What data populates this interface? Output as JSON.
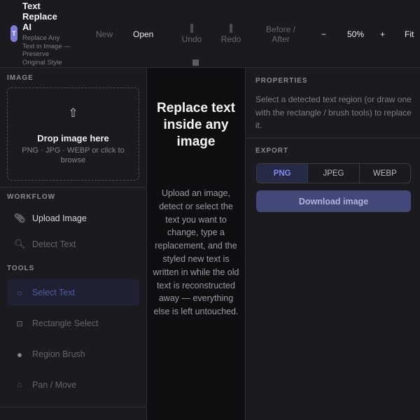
{
  "app": {
    "title": "Text Replace AI",
    "subtitle": "Replace Any Text in Image — Preserve Original Style",
    "logo_letter": "T",
    "accent": "#7f7bd8"
  },
  "toolbar": {
    "new_label": "New",
    "open_label": "Open",
    "undo_label": "Undo",
    "redo_label": "Redo",
    "before_after_label": "Before / After",
    "zoom_out_label": "−",
    "zoom_level": "50%",
    "zoom_in_label": "+",
    "fit_label": "Fit"
  },
  "left_panel": {
    "image_section_label": "IMAGE",
    "dropzone": {
      "icon": "upload-arrow-icon",
      "title": "Drop image here",
      "subtitle": "PNG · JPG · WEBP or click to browse"
    },
    "workflow_label": "WORKFLOW",
    "workflow_items": [
      {
        "label": "Upload Image",
        "icon": "paperclip-icon",
        "enabled": true
      },
      {
        "label": "Detect Text",
        "icon": "magnifier-icon",
        "enabled": false
      }
    ],
    "tools_label": "TOOLS",
    "tool_items": [
      {
        "label": "Select Text",
        "icon": "circle-select-icon",
        "selected": true
      },
      {
        "label": "Rectangle Select",
        "icon": "rectangle-select-icon",
        "selected": false
      },
      {
        "label": "Region Brush",
        "icon": "brush-dot-icon",
        "selected": false
      },
      {
        "label": "Pan / Move",
        "icon": "hand-icon",
        "selected": false
      }
    ]
  },
  "canvas": {
    "title": "Replace text inside any image",
    "body": "Upload an image, detect or select the text you want to change, type a replacement, and the styled new text is written in while the old text is reconstructed away — everything else is left untouched."
  },
  "right_panel": {
    "properties_label": "PROPERTIES",
    "properties_text": "Select a detected text region (or draw one with the rectangle / brush tools) to replace it.",
    "export_label": "EXPORT",
    "formats": [
      {
        "label": "PNG",
        "active": true
      },
      {
        "label": "JPEG",
        "active": false
      },
      {
        "label": "WEBP",
        "active": false
      }
    ],
    "download_label": "Download image"
  }
}
